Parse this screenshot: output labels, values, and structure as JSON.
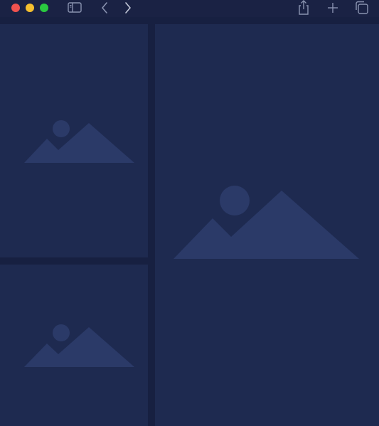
{
  "window": {
    "controls": [
      "close",
      "minimize",
      "zoom"
    ]
  },
  "toolbar": {
    "icons": [
      "sidebar-toggle-icon",
      "back-chevron-icon",
      "forward-chevron-icon",
      "share-icon",
      "plus-icon",
      "tabs-overview-icon"
    ]
  },
  "content": {
    "placeholders": [
      "image-placeholder-icon",
      "image-placeholder-icon",
      "image-placeholder-icon"
    ]
  },
  "colors": {
    "toolbar_bg": "#1a2244",
    "panel_bg": "#1e2a50",
    "divider": "#172041",
    "placeholder_shape": "#2b3a68",
    "icon_stroke": "#8a93b0"
  }
}
